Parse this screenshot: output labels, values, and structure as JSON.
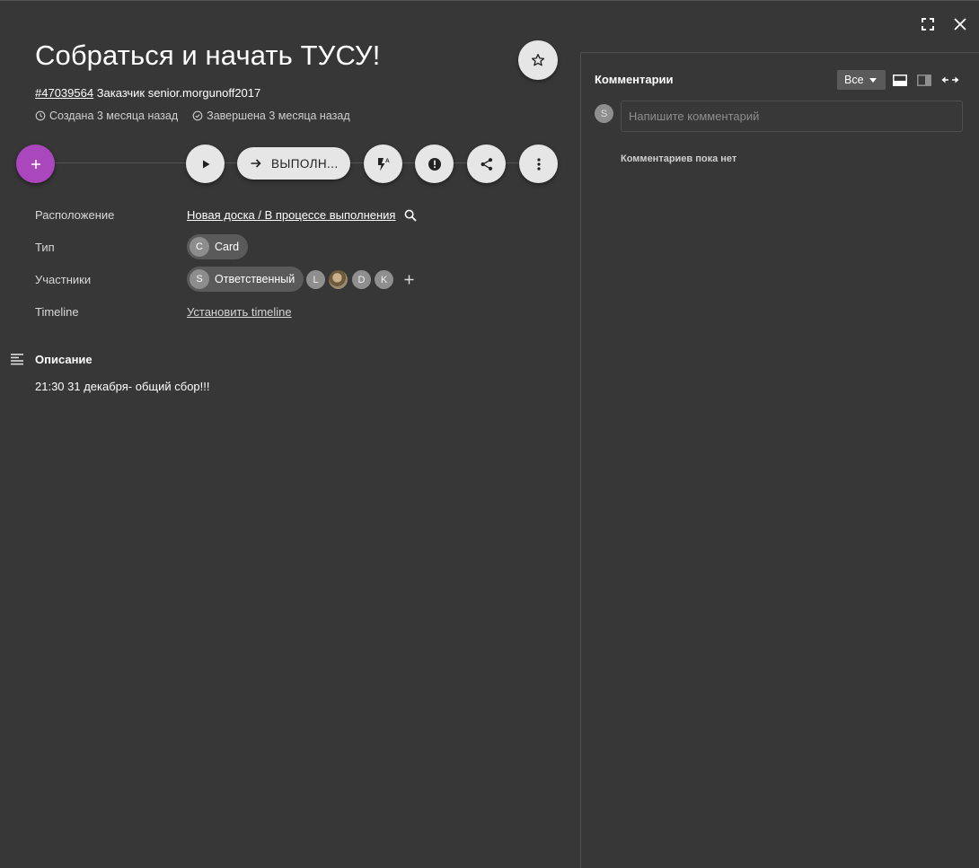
{
  "task": {
    "title": "Собраться и начать ТУСУ!",
    "id": "#47039564",
    "customer_label": "Заказчик",
    "customer": "senior.morgunoff2017",
    "created": "Создана 3 месяца назад",
    "completed": "Завершена 3 месяца назад"
  },
  "actions": {
    "status_label": "ВЫПОЛН...",
    "add_icon": "plus-icon",
    "play_icon": "play-icon",
    "automation_icon": "flash-auto-icon",
    "priority_icon": "alert-circle-icon",
    "share_icon": "share-icon",
    "more_icon": "more-vert-icon"
  },
  "properties": {
    "location_label": "Расположение",
    "location_value": "Новая доска / В процессе выполнения",
    "type_label": "Тип",
    "type_avatar": "C",
    "type_value": "Card",
    "members_label": "Участники",
    "responsible_avatar": "S",
    "responsible_label": "Ответственный",
    "member_avatars": [
      "L",
      "",
      "D",
      "K"
    ],
    "timeline_label": "Timeline",
    "timeline_value": "Установить timeline"
  },
  "description": {
    "title": "Описание",
    "text": "21:30 31 декабря- общий сбор!!!"
  },
  "comments": {
    "title": "Комментарии",
    "filter": "Все",
    "avatar": "S",
    "placeholder": "Напишите комментарий",
    "empty": "Комментариев пока нет"
  },
  "colors": {
    "background": "#373737",
    "accent": "#ab47bc",
    "button": "#e6e6e6"
  }
}
